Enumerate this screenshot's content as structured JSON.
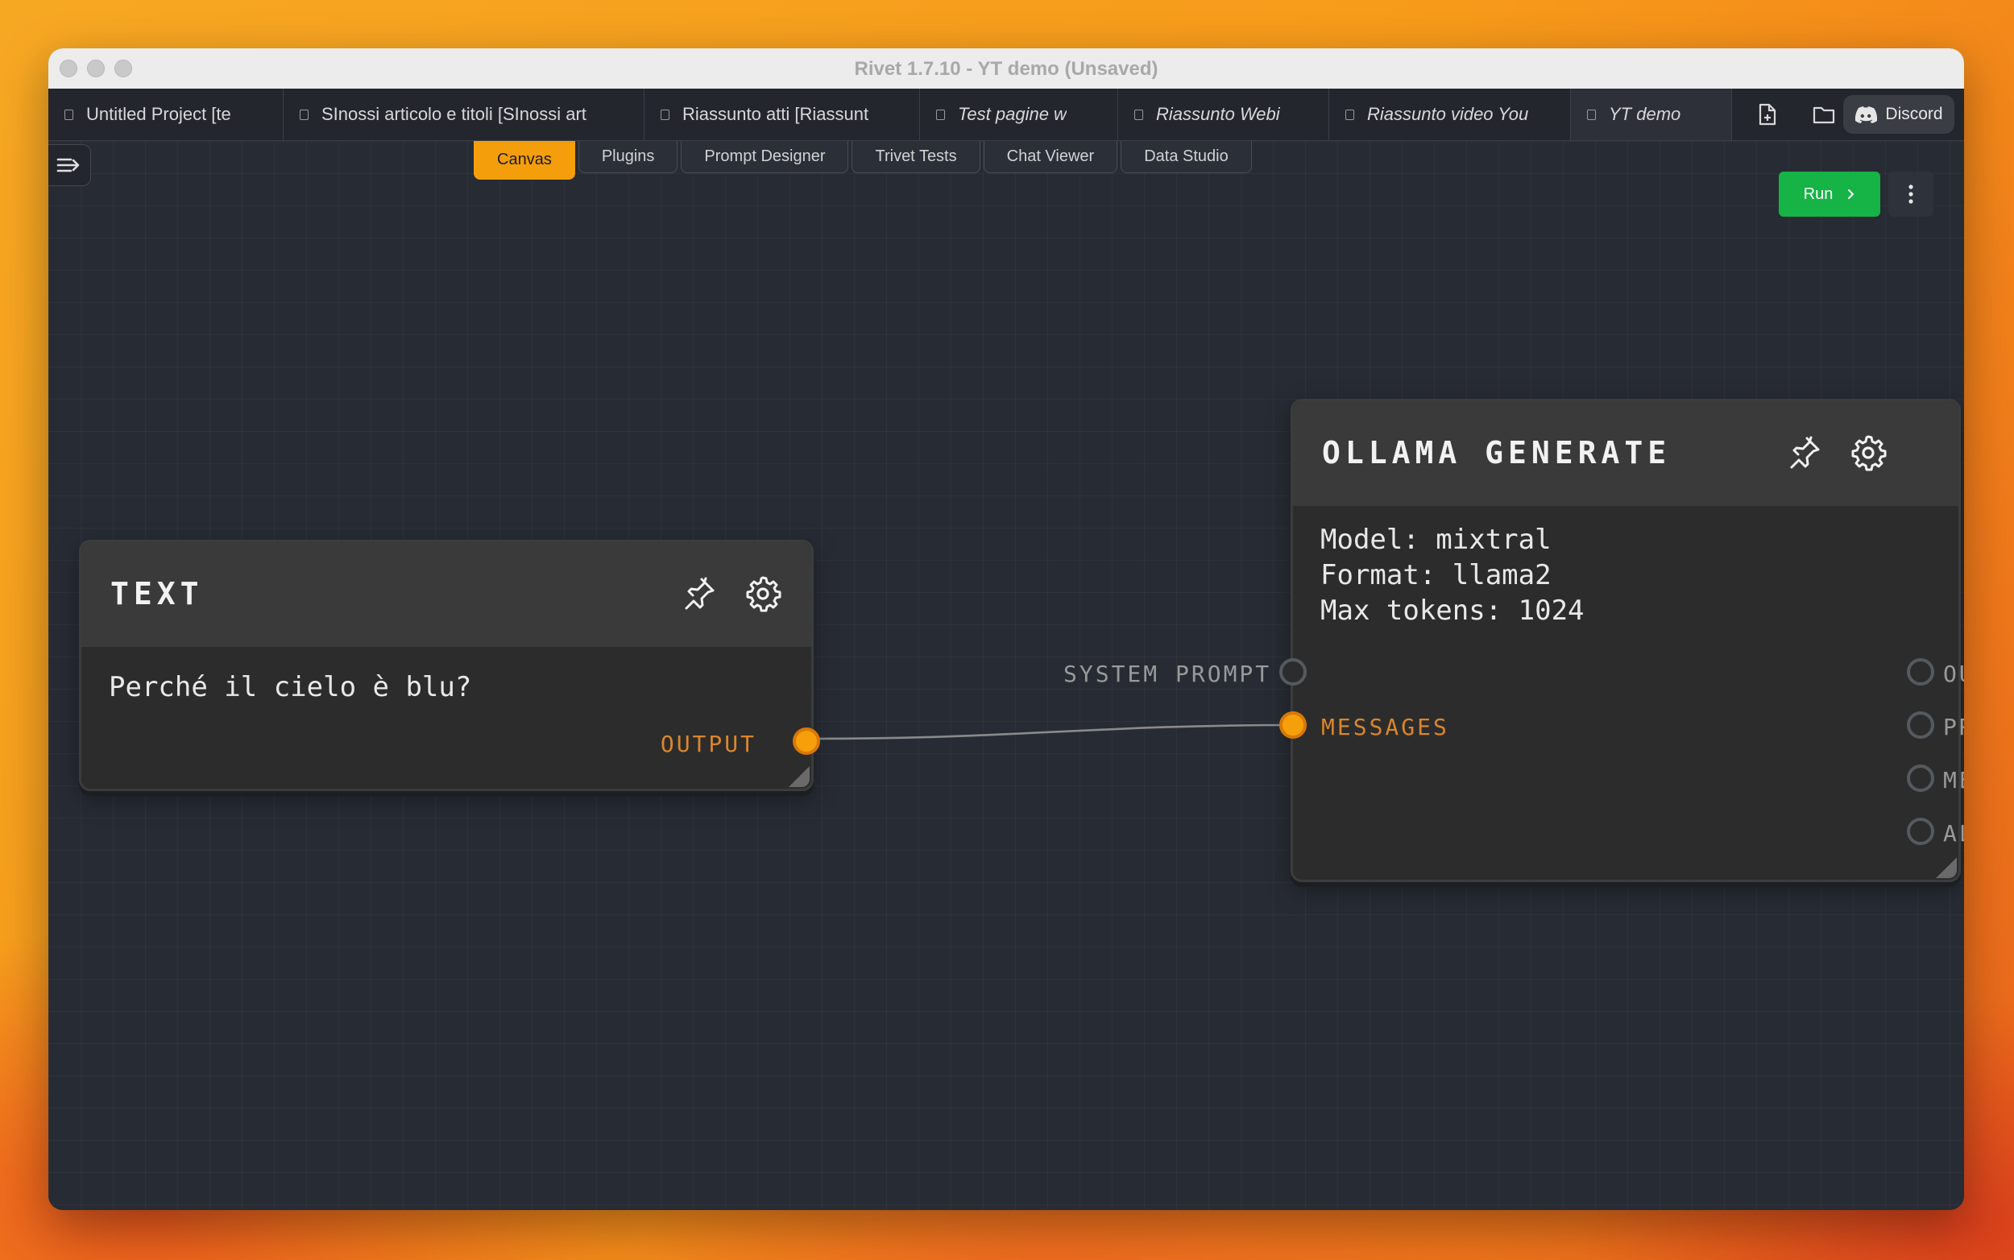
{
  "window": {
    "title": "Rivet 1.7.10 - YT demo (Unsaved)"
  },
  "tabs": [
    {
      "label": "Untitled Project [te",
      "italic": false
    },
    {
      "label": "SInossi articolo e titoli [SInossi art",
      "italic": false
    },
    {
      "label": "Riassunto atti [Riassunt",
      "italic": false
    },
    {
      "label": "Test pagine w",
      "italic": true
    },
    {
      "label": "Riassunto Webi",
      "italic": true
    },
    {
      "label": "Riassunto video You",
      "italic": true
    },
    {
      "label": "YT demo",
      "italic": true,
      "active": true
    }
  ],
  "toolbar": {
    "discord_label": "Discord"
  },
  "view_tabs": [
    "Canvas",
    "Plugins",
    "Prompt Designer",
    "Trivet Tests",
    "Chat Viewer",
    "Data Studio"
  ],
  "active_view": "Canvas",
  "run": {
    "label": "Run"
  },
  "text_node": {
    "title": "TEXT",
    "content": "Perché il cielo è blu?",
    "output_label": "OUTPUT"
  },
  "ollama_node": {
    "title": "OLLAMA GENERATE",
    "lines": [
      "Model: mixtral",
      "Format: llama2",
      "Max tokens: 1024"
    ],
    "inputs": [
      "SYSTEM PROMPT",
      "MESSAGES"
    ],
    "outputs": [
      "OU",
      "PR",
      "ME",
      "AL"
    ]
  },
  "colors": {
    "accent": "#f59e0b",
    "run_green": "#16b346",
    "canvas_bg": "#272b33",
    "node_bg": "#2c2c2c",
    "port_label_connected": "#d9862e",
    "port_label_idle": "#9a9a9a"
  }
}
